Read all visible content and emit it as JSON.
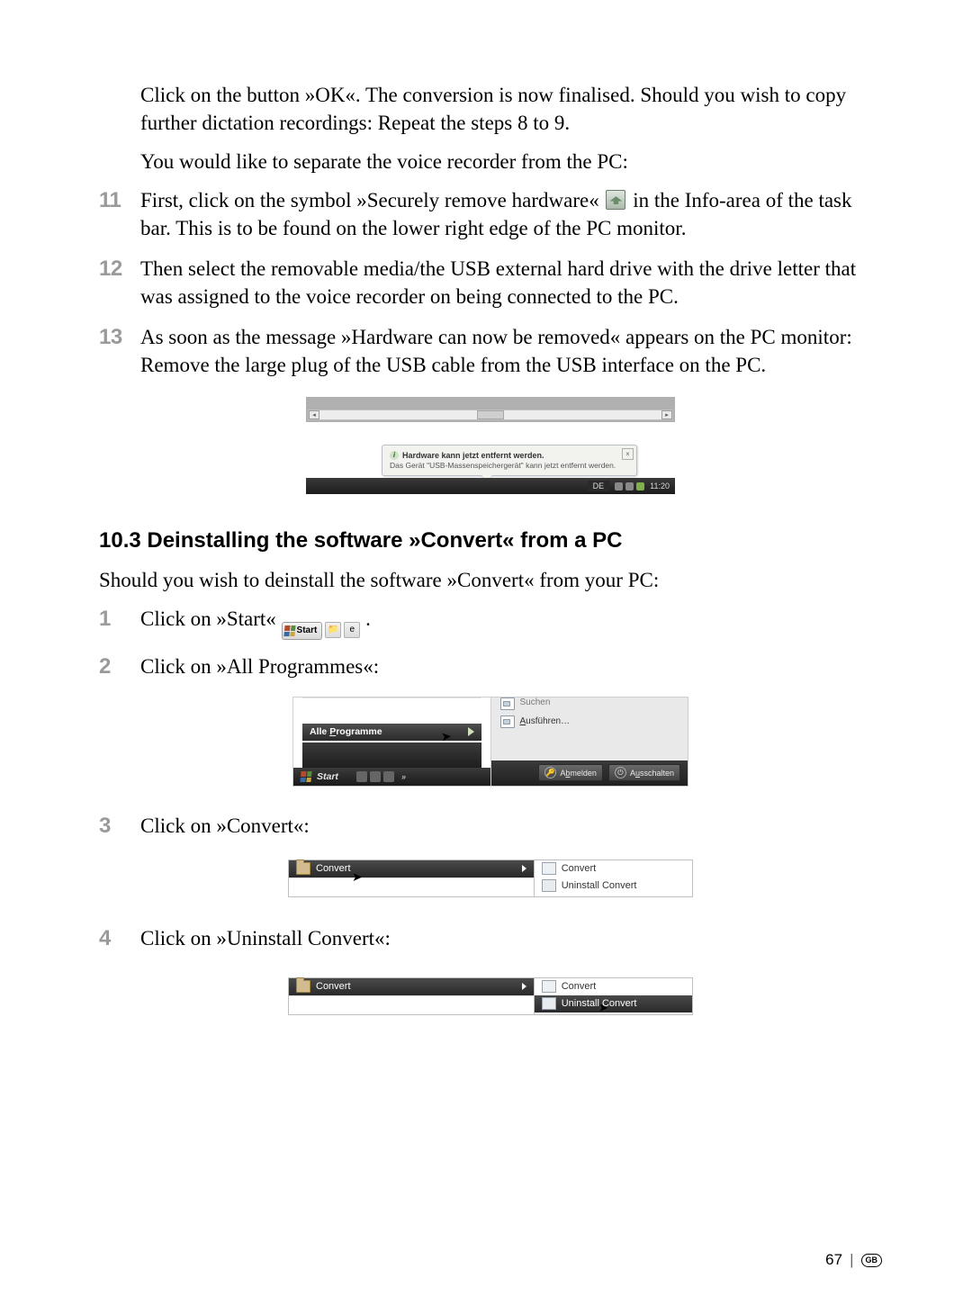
{
  "intro_para": "Click on the button »OK«. The conversion is now finalised. Should you wish to copy further dictation recordings: Repeat the steps 8 to 9.",
  "separate_text": "You would like to separate the voice recorder from the PC:",
  "steps_top": {
    "s11_a": "First, click on the symbol »Securely remove hardware« ",
    "s11_b": " in the Info-area of the task bar. This is to be found on the lower right edge of the PC monitor.",
    "s12": "Then select the removable media/the USB external hard drive with the drive letter that was assigned to the voice recorder on being connected to the PC.",
    "s13": "As soon as the message »Hardware can now be removed« appears on the PC monitor: Remove the large plug of the USB cable from the USB interface on the PC."
  },
  "balloon": {
    "title": "Hardware kann jetzt entfernt werden.",
    "body": "Das Gerät \"USB-Massenspeichergerät\" kann jetzt entfernt werden.",
    "lang": "DE",
    "clock": "11:20"
  },
  "section_head": "10.3 Deinstalling the software »Convert« from a PC",
  "section_intro": "Should you wish to deinstall the software »Convert« from your PC:",
  "steps_bottom": {
    "s1_a": "Click on »Start« ",
    "s1_b": ".",
    "s2": "Click on »All Programmes«:",
    "s3": "Click on »Convert«:",
    "s4": "Click on »Uninstall Convert«:"
  },
  "start_button_label": "Start",
  "startmenu": {
    "all_programs": "Alle Programme",
    "search_cut": "Suchen",
    "run": "Ausführen…",
    "logoff": "Abmelden",
    "shutdown": "Ausschalten",
    "start_label": "Start"
  },
  "convert_menu": {
    "folder": "Convert",
    "app": "Convert",
    "uninstall": "Uninstall Convert"
  },
  "nums": {
    "n11": "11",
    "n12": "12",
    "n13": "13",
    "n1": "1",
    "n2": "2",
    "n3": "3",
    "n4": "4"
  },
  "footer": {
    "page": "67",
    "region": "GB"
  }
}
